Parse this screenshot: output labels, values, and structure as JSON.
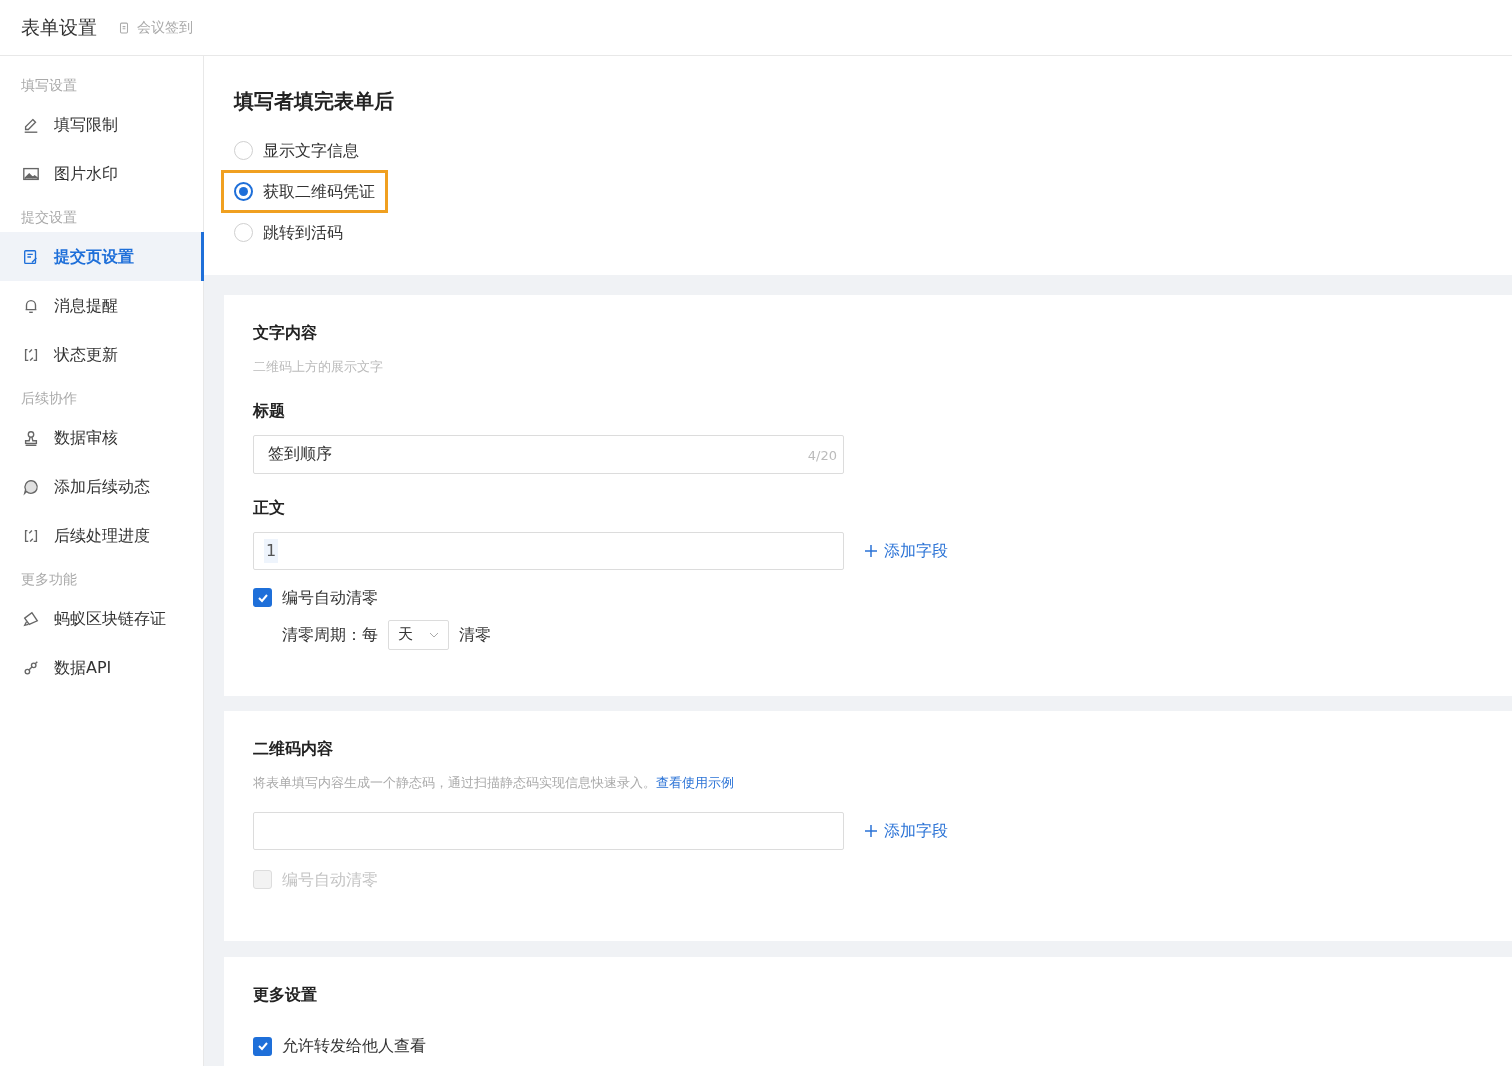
{
  "header": {
    "title": "表单设置",
    "breadcrumb": "会议签到"
  },
  "sidebar": {
    "groups": [
      {
        "heading": "填写设置",
        "items": [
          {
            "label": "填写限制",
            "selected": false
          },
          {
            "label": "图片水印",
            "selected": false
          }
        ]
      },
      {
        "heading": "提交设置",
        "items": [
          {
            "label": "提交页设置",
            "selected": true
          },
          {
            "label": "消息提醒",
            "selected": false
          },
          {
            "label": "状态更新",
            "selected": false
          }
        ]
      },
      {
        "heading": "后续协作",
        "items": [
          {
            "label": "数据审核",
            "selected": false
          },
          {
            "label": "添加后续动态",
            "selected": false
          },
          {
            "label": "后续处理进度",
            "selected": false
          }
        ]
      },
      {
        "heading": "更多功能",
        "items": [
          {
            "label": "蚂蚁区块链存证",
            "selected": false
          },
          {
            "label": "数据API",
            "selected": false
          }
        ]
      }
    ]
  },
  "after_submit": {
    "title": "填写者填完表单后",
    "options": [
      {
        "label": "显示文字信息",
        "selected": false
      },
      {
        "label": "获取二维码凭证",
        "selected": true
      },
      {
        "label": "跳转到活码",
        "selected": false
      }
    ]
  },
  "text_content": {
    "title": "文字内容",
    "description": "二维码上方的展示文字",
    "title_label": "标题",
    "title_value": "签到顺序",
    "title_count": "4/20",
    "body_label": "正文",
    "body_value": "1",
    "add_field": "添加字段",
    "auto_reset": {
      "label": "编号自动清零",
      "checked": true,
      "disabled": false
    },
    "reset_prefix": "清零周期：每",
    "reset_unit": "天",
    "reset_suffix": "清零"
  },
  "qr_content": {
    "title": "二维码内容",
    "description": "将表单填写内容生成一个静态码，通过扫描静态码实现信息快速录入。",
    "link": "查看使用示例",
    "add_field": "添加字段",
    "auto_reset": {
      "label": "编号自动清零",
      "checked": false,
      "disabled": true
    }
  },
  "more_settings": {
    "title": "更多设置",
    "options": [
      {
        "label": "允许转发给他人查看",
        "checked": true,
        "disabled": false
      }
    ]
  }
}
